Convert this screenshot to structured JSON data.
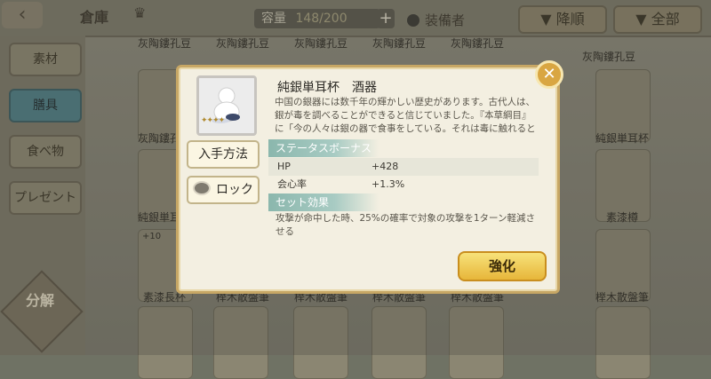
{
  "header": {
    "back_icon": "arrow-left-icon",
    "title": "倉庫",
    "crown_icon": "crown-icon",
    "capacity_label": "容量",
    "capacity_count": "148/200",
    "plus_label": "+",
    "equipped_label": "装備者",
    "sort_label": "降順",
    "filter_label": "全部"
  },
  "sidebar": {
    "tabs": [
      {
        "label": "素材"
      },
      {
        "label": "膳具"
      },
      {
        "label": "食べ物"
      },
      {
        "label": "プレゼント"
      }
    ],
    "sort_seal_label": "分解"
  },
  "grid": {
    "top_labels": [
      "灰陶鏤孔豆",
      "灰陶鏤孔豆",
      "灰陶鏤孔豆",
      "灰陶鏤孔豆",
      "灰陶鏤孔豆",
      "灰陶鏤孔豆"
    ],
    "row2_labels": [
      "灰陶鏤孔豆",
      "純銀単耳杯"
    ],
    "row3_labels": [
      "純銀単耳杯",
      "素漆樽"
    ],
    "row4_labels": [
      "素漆長杯",
      "榉木散盤筆",
      "榉木散盤筆",
      "榉木散盤筆",
      "榉木散盤筆",
      "榉木散盤筆"
    ],
    "badge_level": "+10"
  },
  "modal": {
    "item_name": "純銀単耳杯　酒器",
    "description": "中国の銀器には数千年の輝かしい歴史があります。古代人は、銀が毒を調べることができると信じていました。『本草綱目』に「今の人々は銀の器で食事をしている。それは毒に触れると黒くなるからだ」との記述がある。",
    "stars": "✦✦✦✦",
    "obtain_button": "入手方法",
    "lock_button": "ロック",
    "status_header": "ステータスボーナス",
    "stats": [
      {
        "key": "HP",
        "value": "+428"
      },
      {
        "key": "会心率",
        "value": "+1.3%"
      }
    ],
    "set_header": "セット効果",
    "set_effect": "攻撃が命中した時、25%の確率で対象の攻撃を1ターン軽減させる",
    "enhance_button": "強化",
    "close_icon": "close-icon"
  }
}
